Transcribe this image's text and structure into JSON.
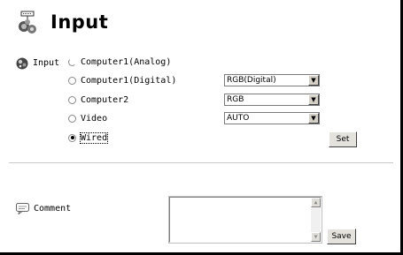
{
  "page": {
    "title": "Input"
  },
  "input_section": {
    "label": "Input",
    "icon": "input-icon",
    "options": [
      {
        "label": "Computer1(Analog)",
        "selected": false
      },
      {
        "label": "Computer1(Digital)",
        "selected": false,
        "dropdown": "RGB(Digital)"
      },
      {
        "label": "Computer2",
        "selected": false,
        "dropdown": "RGB"
      },
      {
        "label": "Video",
        "selected": false,
        "dropdown": "AUTO"
      },
      {
        "label": "Wired",
        "selected": true
      }
    ],
    "set_label": "Set"
  },
  "comment_section": {
    "label": "Comment",
    "icon": "comment-icon",
    "value": "",
    "save_label": "Save"
  },
  "icons": {
    "header": "projector-input-icon",
    "section": "input-icon",
    "comment": "comment-icon",
    "dropdown": "chevron-down-icon",
    "scroll_up": "triangle-up-icon",
    "scroll_down": "triangle-down-icon"
  },
  "colors": {
    "background": "#ffffff",
    "frame": "#000000",
    "button_face": "#e4e2dc",
    "divider": "#c8c8c8"
  }
}
